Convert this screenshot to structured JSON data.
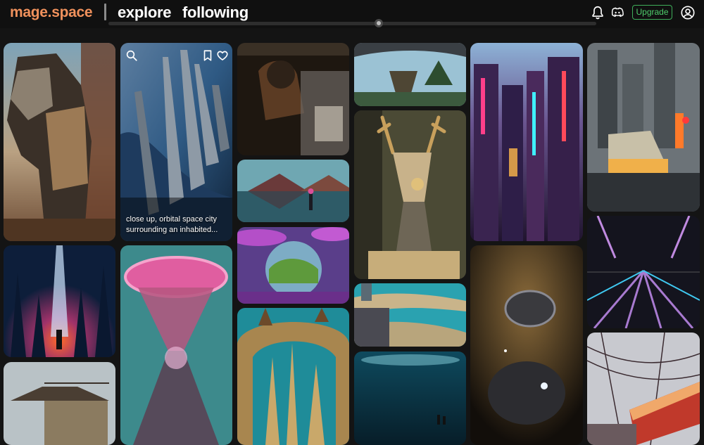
{
  "header": {
    "logo": "mage.space",
    "nav_explore": "explore",
    "nav_following": "following",
    "upgrade_label": "Upgrade",
    "accent_color": "#f0915c",
    "upgrade_color": "#4fcd6c"
  },
  "icons": [
    "bell-icon",
    "discord-icon",
    "user-account-icon",
    "search-icon",
    "bookmark-icon",
    "heart-icon"
  ],
  "gallery": {
    "hovered_caption": "close up, orbital space city surrounding an inhabited...",
    "tiles": [
      {
        "name": "tile-mech-horse"
      },
      {
        "name": "tile-orbital-city"
      },
      {
        "name": "tile-mechanic"
      },
      {
        "name": "tile-floating-island"
      },
      {
        "name": "tile-neon-city"
      },
      {
        "name": "tile-train-rain"
      },
      {
        "name": "tile-portal-light"
      },
      {
        "name": "tile-pink-hourglass"
      },
      {
        "name": "tile-mountain-lake"
      },
      {
        "name": "tile-robot-deer"
      },
      {
        "name": "tile-spaceships"
      },
      {
        "name": "tile-neon-road"
      },
      {
        "name": "tile-glass-dome"
      },
      {
        "name": "tile-coastal-city"
      },
      {
        "name": "tile-water-tower"
      },
      {
        "name": "tile-arch-towers"
      },
      {
        "name": "tile-underwater"
      },
      {
        "name": "tile-train-sunset"
      }
    ]
  }
}
